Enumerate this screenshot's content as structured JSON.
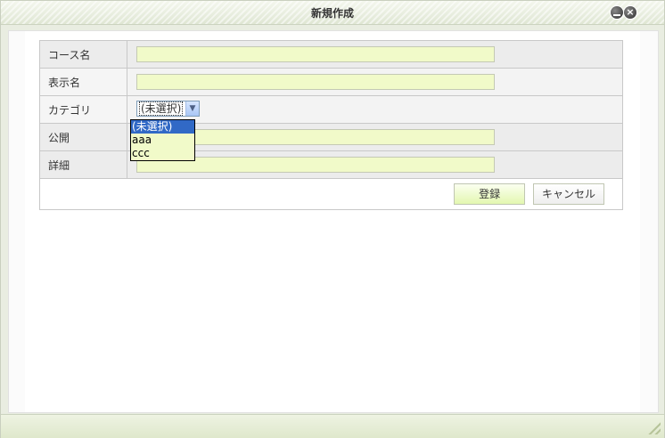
{
  "window": {
    "title": "新規作成"
  },
  "form": {
    "rows": [
      {
        "label": "コース名",
        "value": ""
      },
      {
        "label": "表示名",
        "value": ""
      },
      {
        "label": "カテゴリ",
        "selected": "(未選択)"
      },
      {
        "label": "公開",
        "value": ""
      },
      {
        "label": "詳細",
        "value": ""
      }
    ],
    "category_options": [
      "(未選択)",
      "aaa",
      "ccc"
    ]
  },
  "actions": {
    "register_label": "登録",
    "cancel_label": "キャンセル"
  },
  "colors": {
    "input_bg": "#f1fac9",
    "highlight": "#3169c6",
    "titlebar": "#dfe6d3"
  },
  "icons": {
    "minimize": "minimize-icon",
    "close": "close-icon",
    "dropdown": "chevron-down-icon",
    "resize": "resize-grip-icon"
  }
}
